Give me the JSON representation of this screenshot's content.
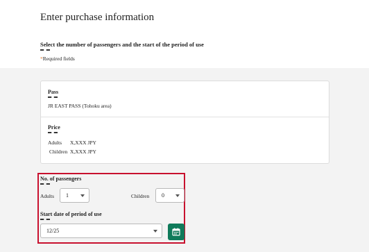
{
  "header": {
    "title": "Enter purchase information",
    "section_title": "Select the number of passengers and the start of the period of use",
    "required_star": "*",
    "required_text": "Required fields"
  },
  "pass": {
    "label": "Pass",
    "value": "JR EAST PASS (Tohoku area)"
  },
  "price": {
    "label": "Price",
    "rows": [
      {
        "name": "Adults",
        "amount": "X,XXX JPY"
      },
      {
        "name": "Children",
        "amount": "X,XXX JPY"
      }
    ]
  },
  "passengers": {
    "label": "No. of passengers",
    "adults_label": "Adults",
    "adults_value": "1",
    "children_label": "Children",
    "children_value": "0"
  },
  "start_date": {
    "label": "Start date of period of use",
    "value": "12/25"
  },
  "colors": {
    "highlight_border": "#c8102e",
    "calendar_button": "#0f7a5a",
    "required_star": "#e07a2f"
  },
  "icons": {
    "calendar": "calendar-icon",
    "dropdown": "chevron-down-icon"
  }
}
